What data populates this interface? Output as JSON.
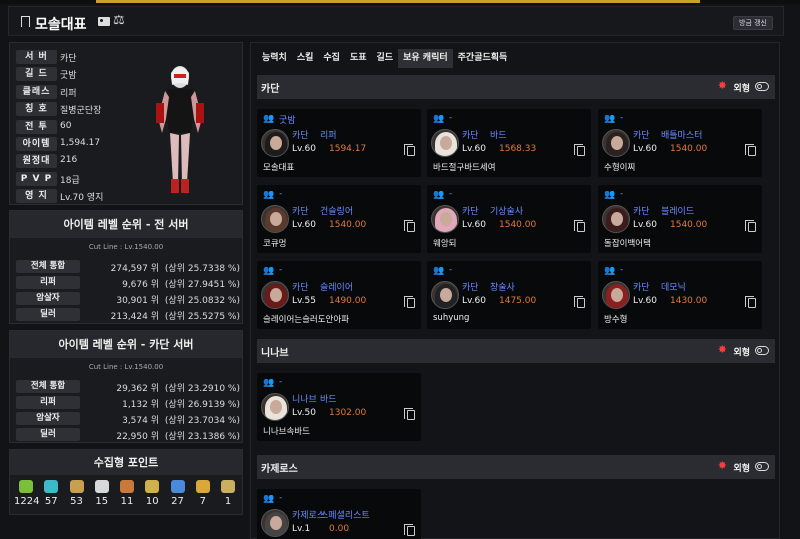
{
  "header": {
    "title": "모솔대표",
    "refresh_label": "방금 갱신"
  },
  "character": {
    "rows": [
      {
        "label": "서 버",
        "value": "카단"
      },
      {
        "label": "길 드",
        "value": "굿밤"
      },
      {
        "label": "클래스",
        "value": "리퍼"
      },
      {
        "label": "칭 호",
        "value": "질병군단장"
      },
      {
        "label": "전 투",
        "value": "60"
      },
      {
        "label": "아이템",
        "value": "1,594.17"
      },
      {
        "label": "원정대",
        "value": "216"
      },
      {
        "label": "P V P",
        "value": "18급"
      },
      {
        "label": "영 지",
        "value": "Lv.70 영지"
      }
    ]
  },
  "rank_all": {
    "title": "아이템 레벨 순위 - 전 서버",
    "cutline": "Cut Line : Lv.1540.00",
    "rows": [
      {
        "label": "전체 통합",
        "rank": "274,597 위",
        "pct": "(상위 25.7338 %)"
      },
      {
        "label": "리퍼",
        "rank": "9,676 위",
        "pct": "(상위 27.9451 %)"
      },
      {
        "label": "암살자",
        "rank": "30,901 위",
        "pct": "(상위 25.0832 %)"
      },
      {
        "label": "딜러",
        "rank": "213,424 위",
        "pct": "(상위 25.5275 %)"
      }
    ]
  },
  "rank_server": {
    "title": "아이템 레벨 순위 - 카단 서버",
    "cutline": "Cut Line : Lv.1540.00",
    "rows": [
      {
        "label": "전체 통합",
        "rank": "29,362 위",
        "pct": "(상위 23.2910 %)"
      },
      {
        "label": "리퍼",
        "rank": "1,132 위",
        "pct": "(상위 26.9139 %)"
      },
      {
        "label": "암살자",
        "rank": "3,574 위",
        "pct": "(상위 23.7034 %)"
      },
      {
        "label": "딜러",
        "rank": "22,950 위",
        "pct": "(상위 23.1386 %)"
      }
    ]
  },
  "collection": {
    "title": "수집형 포인트",
    "items": [
      {
        "icon": "mokoko-seed-icon",
        "color": "#7cbf3a",
        "value": "1224"
      },
      {
        "icon": "island-soul-icon",
        "color": "#3fb8c9",
        "value": "57"
      },
      {
        "icon": "giant-heart-icon",
        "color": "#c9a050",
        "value": "53"
      },
      {
        "icon": "art-icon",
        "color": "#d8d8d8",
        "value": "15"
      },
      {
        "icon": "voyage-icon",
        "color": "#c97a3a",
        "value": "11"
      },
      {
        "icon": "seed-icon",
        "color": "#d0b04a",
        "value": "10"
      },
      {
        "icon": "world-tree-leaf-icon",
        "color": "#4a8ad8",
        "value": "27"
      },
      {
        "icon": "orpheus-star-icon",
        "color": "#d8a83a",
        "value": "7"
      },
      {
        "icon": "memory-orb-icon",
        "color": "#c9b060",
        "value": "1"
      }
    ]
  },
  "tabs": [
    "능력치",
    "스킬",
    "수집",
    "도표",
    "길드",
    "보유 캐릭터",
    "주간골드획득"
  ],
  "active_tab": 5,
  "outfit_label": "외형",
  "servers": [
    {
      "name": "카단",
      "characters": [
        {
          "guild": "굿밤",
          "server": "카단",
          "class": "리퍼",
          "level": "Lv.60",
          "item_level": "1594.17",
          "name": "모솔대표",
          "hair": "#1c1c1c"
        },
        {
          "guild": "-",
          "server": "카단",
          "class": "바드",
          "level": "Lv.60",
          "item_level": "1568.33",
          "name": "바드절구바드세여",
          "hair": "#e8e4dc"
        },
        {
          "guild": "-",
          "server": "카단",
          "class": "배틀마스터",
          "level": "Lv.60",
          "item_level": "1540.00",
          "name": "수형이찌",
          "hair": "#2a2220"
        },
        {
          "guild": "-",
          "server": "카단",
          "class": "건슬링어",
          "level": "Lv.60",
          "item_level": "1540.00",
          "name": "코큐멍",
          "hair": "#5a3a2a"
        },
        {
          "guild": "-",
          "server": "카단",
          "class": "기상술사",
          "level": "Lv.60",
          "item_level": "1540.00",
          "name": "웨앙되",
          "hair": "#e0a8b8"
        },
        {
          "guild": "-",
          "server": "카단",
          "class": "블레이드",
          "level": "Lv.60",
          "item_level": "1540.00",
          "name": "돌잡이백어택",
          "hair": "#3a1c1c"
        },
        {
          "guild": "-",
          "server": "카단",
          "class": "슬레이어",
          "level": "Lv.55",
          "item_level": "1490.00",
          "name": "슬레이어는슬러도안아파",
          "hair": "#6a1a1a"
        },
        {
          "guild": "-",
          "server": "카단",
          "class": "창술사",
          "level": "Lv.60",
          "item_level": "1475.00",
          "name": "suhyung",
          "hair": "#222226"
        },
        {
          "guild": "-",
          "server": "카단",
          "class": "데모닉",
          "level": "Lv.60",
          "item_level": "1430.00",
          "name": "방수형",
          "hair": "#8a2020"
        }
      ]
    },
    {
      "name": "니나브",
      "characters": [
        {
          "guild": "-",
          "server": "니나브",
          "class": "바드",
          "level": "Lv.50",
          "item_level": "1302.00",
          "name": "니나브속바드",
          "hair": "#e8e4dc"
        }
      ]
    },
    {
      "name": "카제로스",
      "characters": [
        {
          "guild": "-",
          "server": "카제로스",
          "class": "스페셜리스트",
          "level": "Lv.1",
          "item_level": "0.00",
          "name": "",
          "hair": "#444"
        }
      ]
    }
  ]
}
